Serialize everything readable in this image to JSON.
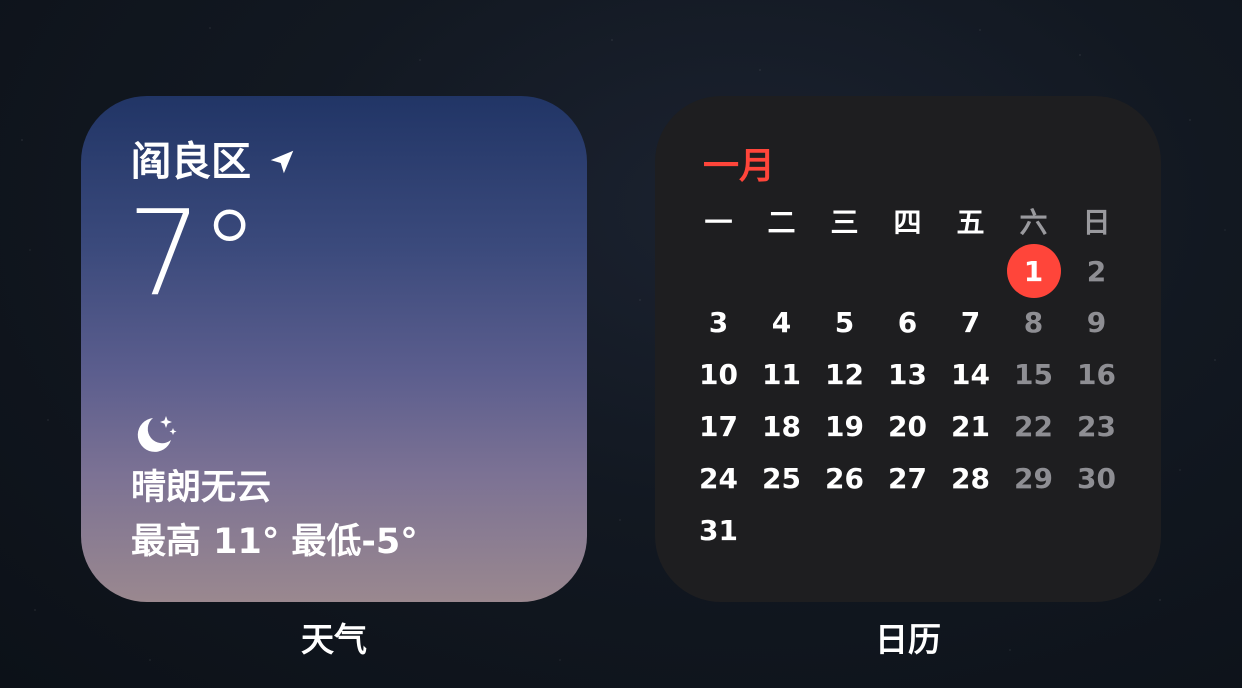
{
  "weather": {
    "location": "阎良区",
    "temperature": "7°",
    "condition_icon": "moon-stars-icon",
    "condition": "晴朗无云",
    "high": "最高 11°",
    "low": "最低-5°",
    "app_label": "天气"
  },
  "calendar": {
    "month": "一月",
    "weekdays": [
      "一",
      "二",
      "三",
      "四",
      "五",
      "六",
      "日"
    ],
    "weeks": [
      [
        "",
        "",
        "",
        "",
        "",
        "1",
        "2"
      ],
      [
        "3",
        "4",
        "5",
        "6",
        "7",
        "8",
        "9"
      ],
      [
        "10",
        "11",
        "12",
        "13",
        "14",
        "15",
        "16"
      ],
      [
        "17",
        "18",
        "19",
        "20",
        "21",
        "22",
        "23"
      ],
      [
        "24",
        "25",
        "26",
        "27",
        "28",
        "29",
        "30"
      ],
      [
        "31",
        "",
        "",
        "",
        "",
        "",
        ""
      ]
    ],
    "today": "1",
    "app_label": "日历"
  },
  "colors": {
    "accent_red": "#ff453a",
    "weekend_gray": "#8e8e93"
  }
}
